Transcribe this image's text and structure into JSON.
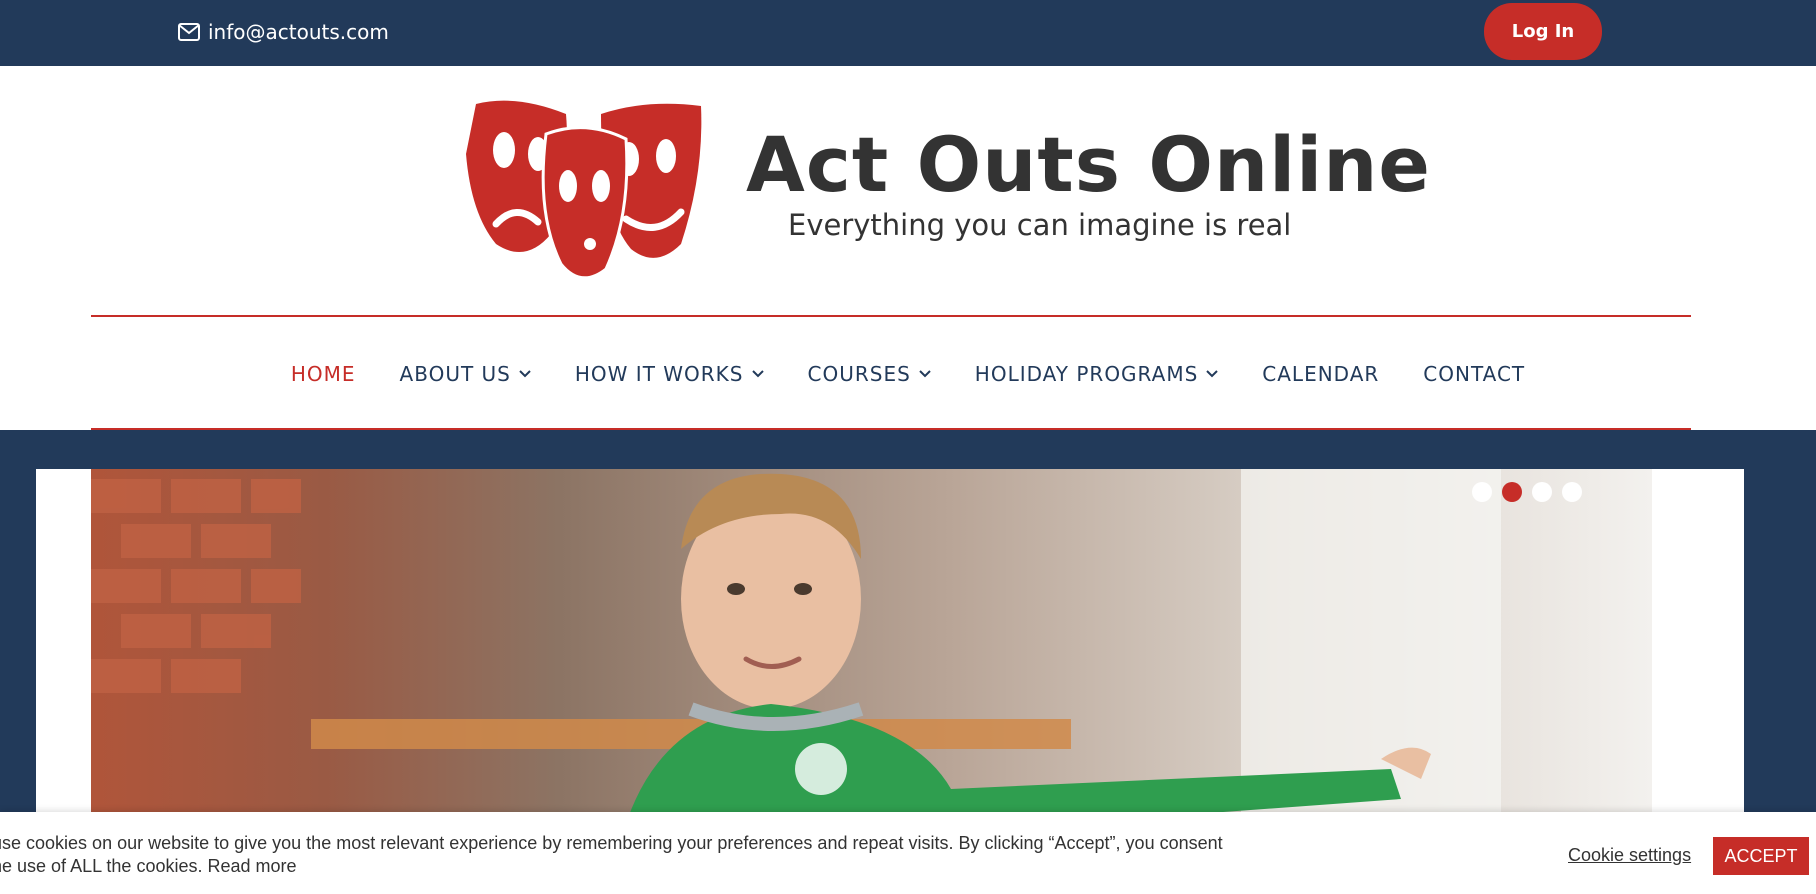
{
  "colors": {
    "navy": "#223a5a",
    "brand_red": "#c62d28",
    "logo_text": "#333333",
    "white": "#ffffff"
  },
  "topbar": {
    "email_icon": "envelope-icon",
    "email": "info@actouts.com",
    "login_label": "Log In"
  },
  "logo": {
    "icon": "theatre-masks-icon",
    "title": "Act Outs Online",
    "tagline": "Everything you can imagine is real"
  },
  "nav": {
    "items": [
      {
        "label": "HOME",
        "active": true,
        "dropdown": false
      },
      {
        "label": "ABOUT US",
        "active": false,
        "dropdown": true
      },
      {
        "label": "HOW IT WORKS",
        "active": false,
        "dropdown": true
      },
      {
        "label": "COURSES",
        "active": false,
        "dropdown": true
      },
      {
        "label": "HOLIDAY PROGRAMS",
        "active": false,
        "dropdown": true
      },
      {
        "label": "CALENDAR",
        "active": false,
        "dropdown": false
      },
      {
        "label": "CONTACT",
        "active": false,
        "dropdown": false
      }
    ]
  },
  "hero": {
    "slide_count": 4,
    "active_slide": 2,
    "image_subject": "boy-green-sweater-photo"
  },
  "cookie": {
    "text": "use cookies on our website to give you the most relevant experience by remembering your preferences and repeat visits. By clicking “Accept”, you consent he use of ALL the cookies.",
    "line1": "use cookies on our website to give you the most relevant experience by remembering your preferences and repeat visits. By clicking “Accept”, you consent",
    "line2": "he use of ALL the cookies.",
    "read_more": "Read more",
    "settings_label": "Cookie settings",
    "accept_label": "ACCEPT"
  }
}
